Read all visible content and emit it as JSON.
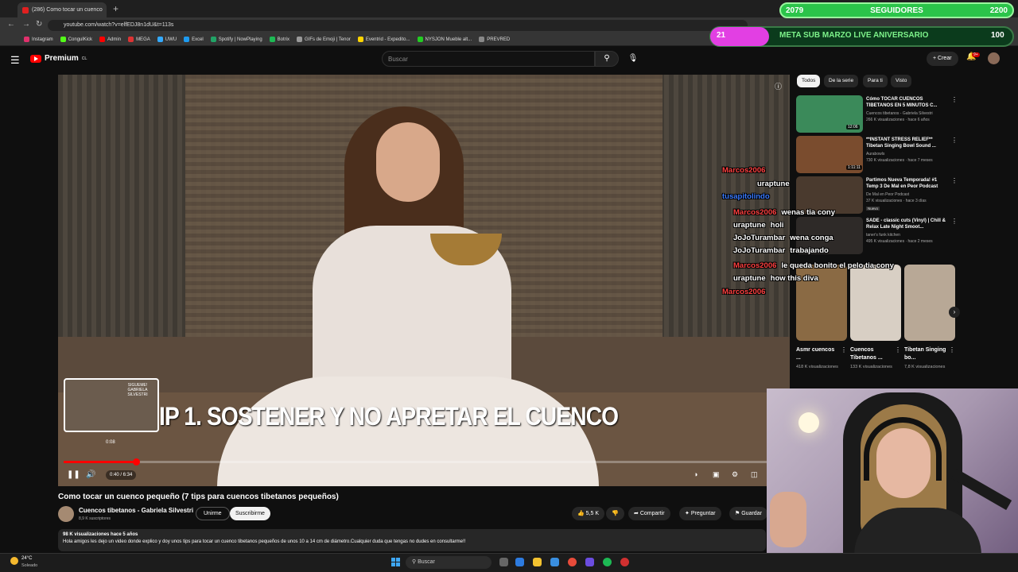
{
  "browser": {
    "tab_title": "(286) Como tocar un cuenco",
    "new_tab": "+",
    "url": "youtube.com/watch?v=elfEDJ8n1dU&t=113s",
    "bookmarks": [
      "Instagram",
      "CongulKick",
      "Admin",
      "MEGA",
      "UWU",
      "Excel",
      "Spotify | NowPlaying",
      "Botrix",
      "GIFs de Emoji | Tenor",
      "Eventrid - Expedito...",
      "NYSJON Mueble alt...",
      "PREVRED"
    ]
  },
  "youtube_header": {
    "logo": "Premium",
    "logo_region": "CL",
    "search_placeholder": "Buscar",
    "create_label": "Crear",
    "notification_count": "9+"
  },
  "stream_overlay": {
    "followers_current": "2079",
    "followers_label": "SEGUIDORES",
    "followers_goal": "2200",
    "followers_progress": 0.945,
    "meta_pill": "21",
    "meta_label": "META SUB MARZO LIVE ANIVERSARIO",
    "meta_goal": "100"
  },
  "player": {
    "subtitle": "IP 1.  SOSTENER Y NO APRETAR EL CUENCO",
    "preview_label": "SIGUEME! GABRIELA SILVESTRI",
    "preview_time": "0:08",
    "time_display": "0:40 / 6:34",
    "progress": 0.1
  },
  "video": {
    "title": "Como tocar un cuenco pequeño (7 tips para cuencos tibetanos pequeños)",
    "channel_name": "Cuencos tibetanos - Gabriela Silvestri",
    "channel_subs": "8,9 K suscriptores",
    "join_label": "Unirme",
    "subscribe_label": "Suscribirme",
    "likes": "5,5 K",
    "share_label": "Compartir",
    "ask_label": "Preguntar",
    "save_label": "Guardar",
    "views_date": "98 K visualizaciones  hace 5 años",
    "description": "Hola amigos les dejo un video donde explico y doy unos tips para tocar un cuenco tibetanos pequeños de unos 10 a 14 cm de diámetro.Cualquier duda que tengas no dudes en consultarme!!"
  },
  "filter_chips": [
    "Todos",
    "De la serie",
    "Para ti",
    "Visto"
  ],
  "recommendations": [
    {
      "title": "Cómo TOCAR  CUENCOS TIBETANOS EN 5 MINUTOS C...",
      "channel": "Cuencos tibetanos - Gabriela Silvestri",
      "views": "266 K visualizaciones · hace 6 años",
      "duration": "12:06",
      "color": "#3b8a5a"
    },
    {
      "title": "**INSTANT STRESS RELIEF** Tibetan Singing Bowl Sound ...",
      "channel": "Aurabowls",
      "views": "730 K visualizaciones · hace 7 meses",
      "duration": "1:11:11",
      "color": "#7a4c2e"
    },
    {
      "title": "Partimos Nueva Temporada! #1 Temp 3 De Mal en Peor Podcast",
      "channel": "De Mal en Peor Podcast",
      "views": "37 K visualizaciones · hace 3 días",
      "badge": "Nuevo",
      "color": "#4a3a2e"
    },
    {
      "title": "SADE - classic cuts (Vinyl) | Chill & Relax Late Night Smoot...",
      "channel": "taner's funk kitchen",
      "views": "495 K visualizaciones · hace 2 meses",
      "color": "#2e2a28"
    }
  ],
  "shorts": [
    {
      "title": "Asmr cuencos ...",
      "views": "418 K visualizaciones",
      "color": "#8a6a44"
    },
    {
      "title": "Cuencos Tibetanos ...",
      "views": "133 K visualizaciones",
      "color": "#d8cfc4"
    },
    {
      "title": "Tibetan Singing bo...",
      "views": "7,8 K visualizaciones",
      "color": "#b8a896"
    }
  ],
  "chat": [
    {
      "user": "Marcos2006",
      "text": "",
      "color": "#ff4040"
    },
    {
      "user": "uraptune",
      "text": "",
      "color": "#ffffff"
    },
    {
      "user": "tusapitolindo",
      "text": "",
      "color": "#3a7aff"
    },
    {
      "user": "Marcos2006",
      "text": "wenas tia cony",
      "color": "#ff4040"
    },
    {
      "user": "uraptune",
      "text": "holi",
      "color": "#ffffff"
    },
    {
      "user": "JoJoTurambar",
      "text": "wena conga",
      "color": "#ffffff"
    },
    {
      "user": "JoJoTurambar",
      "text": "trabajando",
      "color": "#ffffff"
    },
    {
      "user": "Marcos2006",
      "text": "le queda bonito el pelo tia cony",
      "color": "#ff4040"
    },
    {
      "user": "uraptune",
      "text": "how this diva",
      "color": "#ffffff"
    },
    {
      "user": "Marcos2006",
      "text": "",
      "color": "#ff4040"
    }
  ],
  "taskbar": {
    "temp": "24°C",
    "condition": "Soleado",
    "search_label": "Buscar"
  }
}
